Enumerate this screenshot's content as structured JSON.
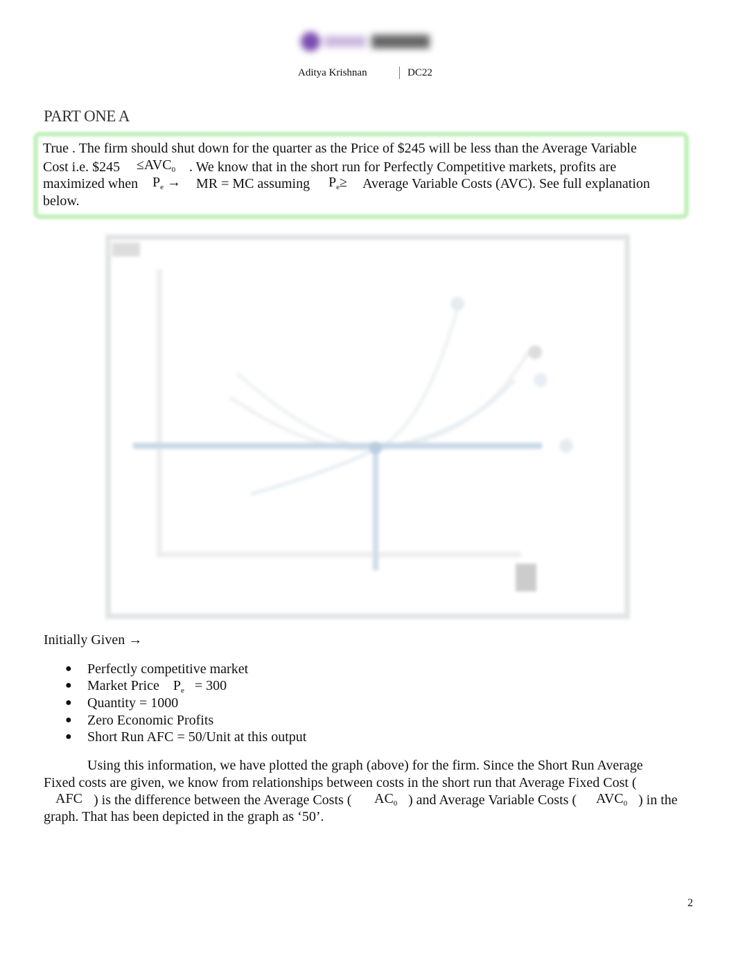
{
  "header": {
    "logo_text": "Study Stream",
    "author": "Aditya Krishnan",
    "separator": "|",
    "code": "DC22"
  },
  "section": {
    "title": "PART ONE A"
  },
  "answer_box": {
    "line1": "True . The firm should shut down for the quarter as the Price of $245 will be less than the Average Variable",
    "line2a": "Cost i.e. $245",
    "line2b": "≤AVC",
    "line2b_sub": "0",
    "line2c": ". We know that in the short run for Perfectly Competitive markets, profits are",
    "line3a": "maximized when",
    "line3b": "P",
    "line3b_sub": "e",
    "line3c": "→",
    "line3d": "MR = MC assuming",
    "line3e": "P",
    "line3e_sub": "e",
    "line3f": "≥",
    "line3g": "Average Variable Costs (AVC). See full explanation",
    "line4": "below.",
    "border_color": "#c4f2be"
  },
  "graph": {
    "curve_color": "#b9cde0"
  },
  "given": {
    "heading": "Initially Given →",
    "items": [
      {
        "text": "Perfectly competitive market"
      },
      {
        "text": "Market Price",
        "sym": "P",
        "sub": "e",
        "rest": "= 300"
      },
      {
        "text": "Quantity = 1000"
      },
      {
        "text": "Zero Economic Profits"
      },
      {
        "text": "Short Run AFC = 50/Unit at this output"
      }
    ],
    "bullet": "●"
  },
  "paragraph": {
    "line1": "Using this information, we have plotted the graph (above) for the firm. Since the Short Run Average",
    "line2": "Fixed costs are given, we know from relationships between costs in the short run that Average Fixed Cost (",
    "line3a": "AFC",
    "line3b": ") is the difference between the Average Costs (",
    "line3c": "AC",
    "line3c_sub": "0",
    "line3d": ") and Average Variable Costs (",
    "line3e": "AVC",
    "line3e_sub": "0",
    "line3f": ") in the",
    "line4": "graph. That has been depicted in the graph as ‘50’."
  },
  "page_number": "2"
}
